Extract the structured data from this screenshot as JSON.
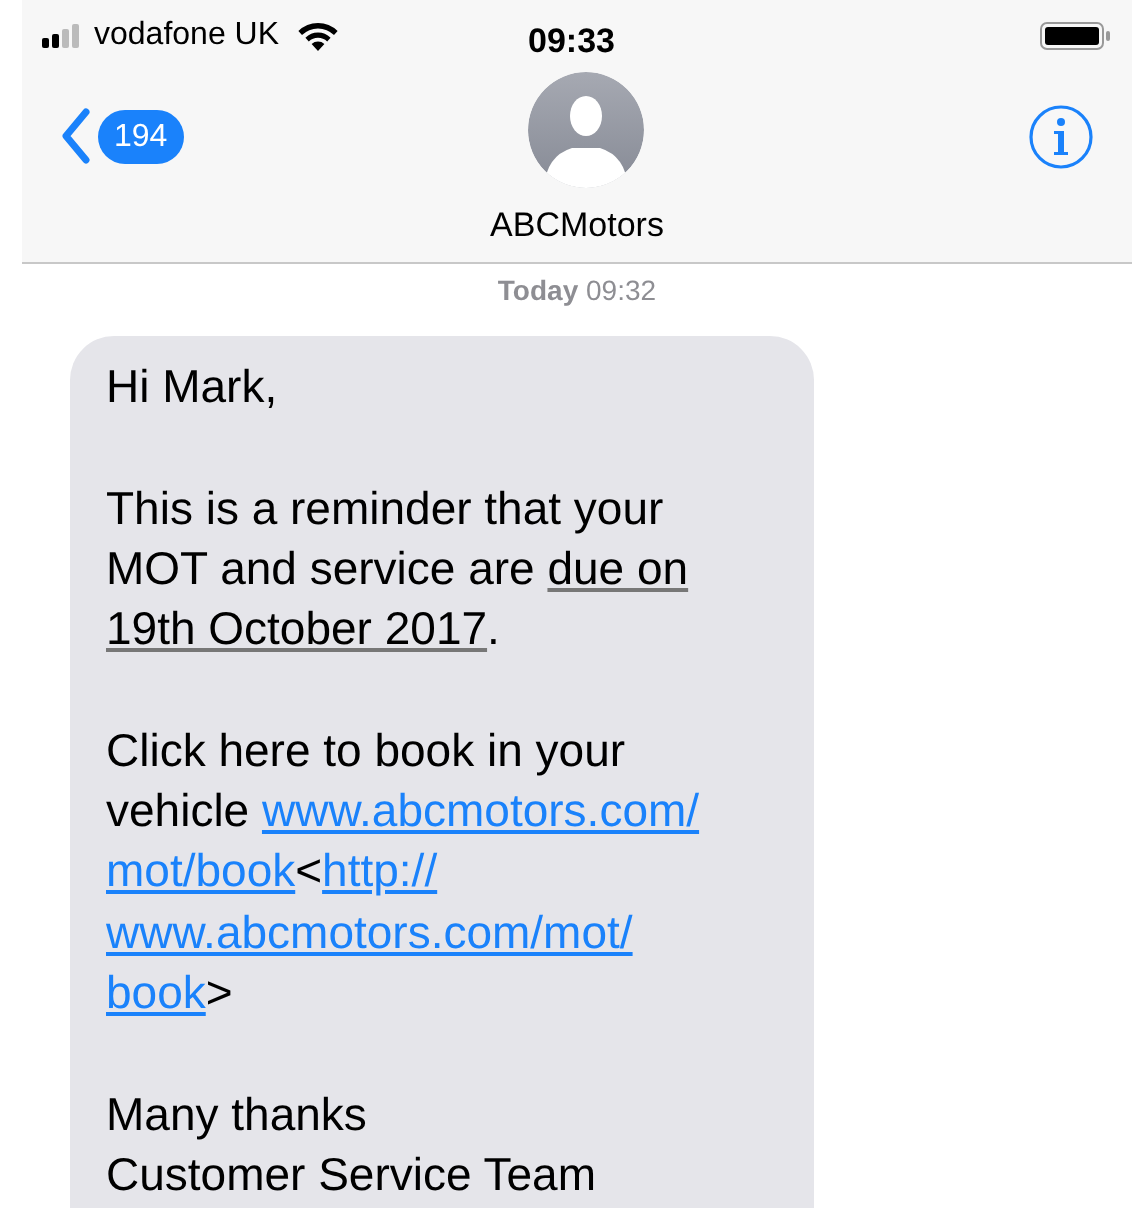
{
  "status_bar": {
    "carrier": "vodafone UK",
    "time": "09:33"
  },
  "header": {
    "back_count": "194",
    "contact_name": "ABCMotors"
  },
  "timestamp": {
    "day": "Today",
    "time": "09:32"
  },
  "messages": [
    {
      "kind": "incoming",
      "paragraphs": [
        [
          [
            {
              "kind": "text",
              "text": "Hi Mark,"
            }
          ]
        ],
        [
          [
            {
              "kind": "text",
              "text": "This is a reminder that your"
            }
          ],
          [
            {
              "kind": "text",
              "text": "MOT and service are "
            },
            {
              "kind": "date",
              "text": "due on"
            }
          ],
          [
            {
              "kind": "date",
              "text": "19th October 2017"
            },
            {
              "kind": "text",
              "text": "."
            }
          ]
        ],
        [
          [
            {
              "kind": "text",
              "text": "Click here to book in your"
            }
          ],
          [
            {
              "kind": "text",
              "text": "vehicle "
            },
            {
              "kind": "link",
              "text": "www.abcmotors.com/"
            }
          ],
          [
            {
              "kind": "link",
              "text": "mot/book"
            },
            {
              "kind": "text",
              "text": "<"
            },
            {
              "kind": "link",
              "text": "http://"
            }
          ],
          [
            {
              "kind": "link",
              "text": "www.abcmotors.com/mot/"
            }
          ],
          [
            {
              "kind": "link",
              "text": "book"
            },
            {
              "kind": "text",
              "text": ">"
            }
          ]
        ],
        [
          [
            {
              "kind": "text",
              "text": "Many thanks"
            }
          ],
          [
            {
              "kind": "text",
              "text": "Customer Service Team"
            }
          ]
        ]
      ]
    }
  ]
}
